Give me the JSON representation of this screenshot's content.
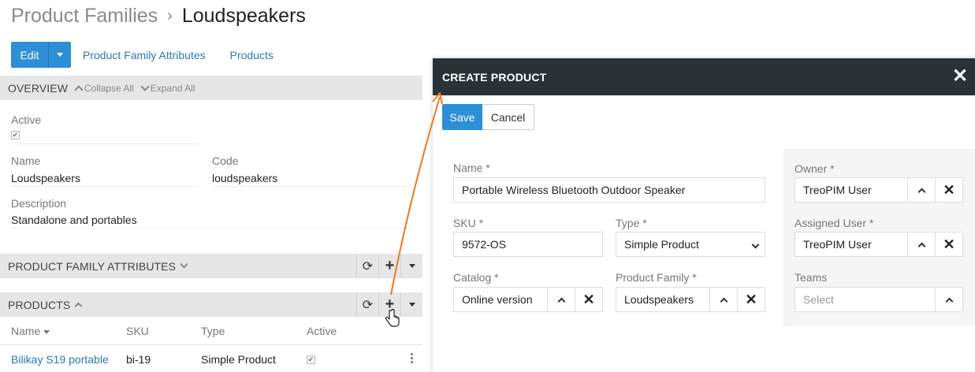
{
  "breadcrumb": {
    "parent": "Product Families",
    "separator": "›",
    "current": "Loudspeakers"
  },
  "toolbar": {
    "edit_label": "Edit",
    "links": [
      "Product Family Attributes",
      "Products"
    ]
  },
  "overview": {
    "title": "OVERVIEW",
    "collapse_all": "Collapse All",
    "expand_all": "Expand All",
    "fields": {
      "active_label": "Active",
      "active_checked": true,
      "name_label": "Name",
      "name_value": "Loudspeakers",
      "code_label": "Code",
      "code_value": "loudspeakers",
      "description_label": "Description",
      "description_value": "Standalone and portables"
    }
  },
  "attributes_panel": {
    "title": "PRODUCT FAMILY ATTRIBUTES"
  },
  "products_panel": {
    "title": "PRODUCTS",
    "columns": [
      "Name",
      "SKU",
      "Type",
      "Active"
    ],
    "rows": [
      {
        "name": "Bilikay S19 portable",
        "sku": "bi-19",
        "type": "Simple Product",
        "active": true
      }
    ]
  },
  "modal": {
    "title": "CREATE PRODUCT",
    "save_label": "Save",
    "cancel_label": "Cancel",
    "fields": {
      "name_label": "Name *",
      "name_value": "Portable Wireless Bluetooth Outdoor Speaker",
      "sku_label": "SKU *",
      "sku_value": "9572-OS",
      "type_label": "Type *",
      "type_value": "Simple Product",
      "catalog_label": "Catalog *",
      "catalog_value": "Online version",
      "family_label": "Product Family *",
      "family_value": "Loudspeakers",
      "owner_label": "Owner *",
      "owner_value": "TreoPIM User",
      "assigned_label": "Assigned User *",
      "assigned_value": "TreoPIM User",
      "teams_label": "Teams",
      "teams_placeholder": "Select"
    }
  },
  "colors": {
    "primary": "#2d8fd5",
    "link": "#2a7ab8",
    "modal_header": "#2a3238",
    "arrow": "#f07a1e",
    "panel_header": "#e6e6e6"
  }
}
